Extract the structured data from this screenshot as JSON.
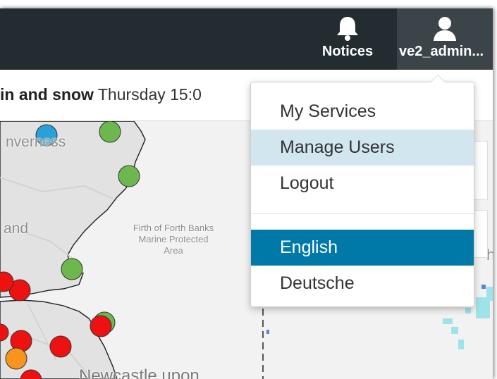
{
  "topbar": {
    "notices_label": "Notices",
    "user_label": "ve2_admin...",
    "notices_icon": "bell-icon",
    "user_icon": "user-icon"
  },
  "infobar": {
    "bold_text": "in and snow",
    "rest_text": " Thursday 15:0"
  },
  "dropdown": {
    "items": [
      {
        "label": "My Services"
      },
      {
        "label": "Manage Users",
        "state": "hover"
      },
      {
        "label": "Logout"
      }
    ],
    "languages": [
      {
        "label": "English",
        "selected": true
      },
      {
        "label": "Deutsche"
      }
    ]
  },
  "map": {
    "labels": {
      "inverness": "nverness",
      "land": "and",
      "forth_line1": "Firth of Forth Banks",
      "forth_line2": "Marine Protected",
      "forth_line3": "Area",
      "newcastle": "Newcastle upon",
      "edge": "h"
    }
  },
  "colors": {
    "topbar": "#232c30",
    "user_bg": "#3a4449",
    "active": "#0079a9",
    "hover": "#d1e6ef",
    "marker_green": "#6cb84e",
    "marker_red": "#ee1111",
    "marker_blue": "#2a9fd8",
    "marker_orange": "#f7941d"
  }
}
